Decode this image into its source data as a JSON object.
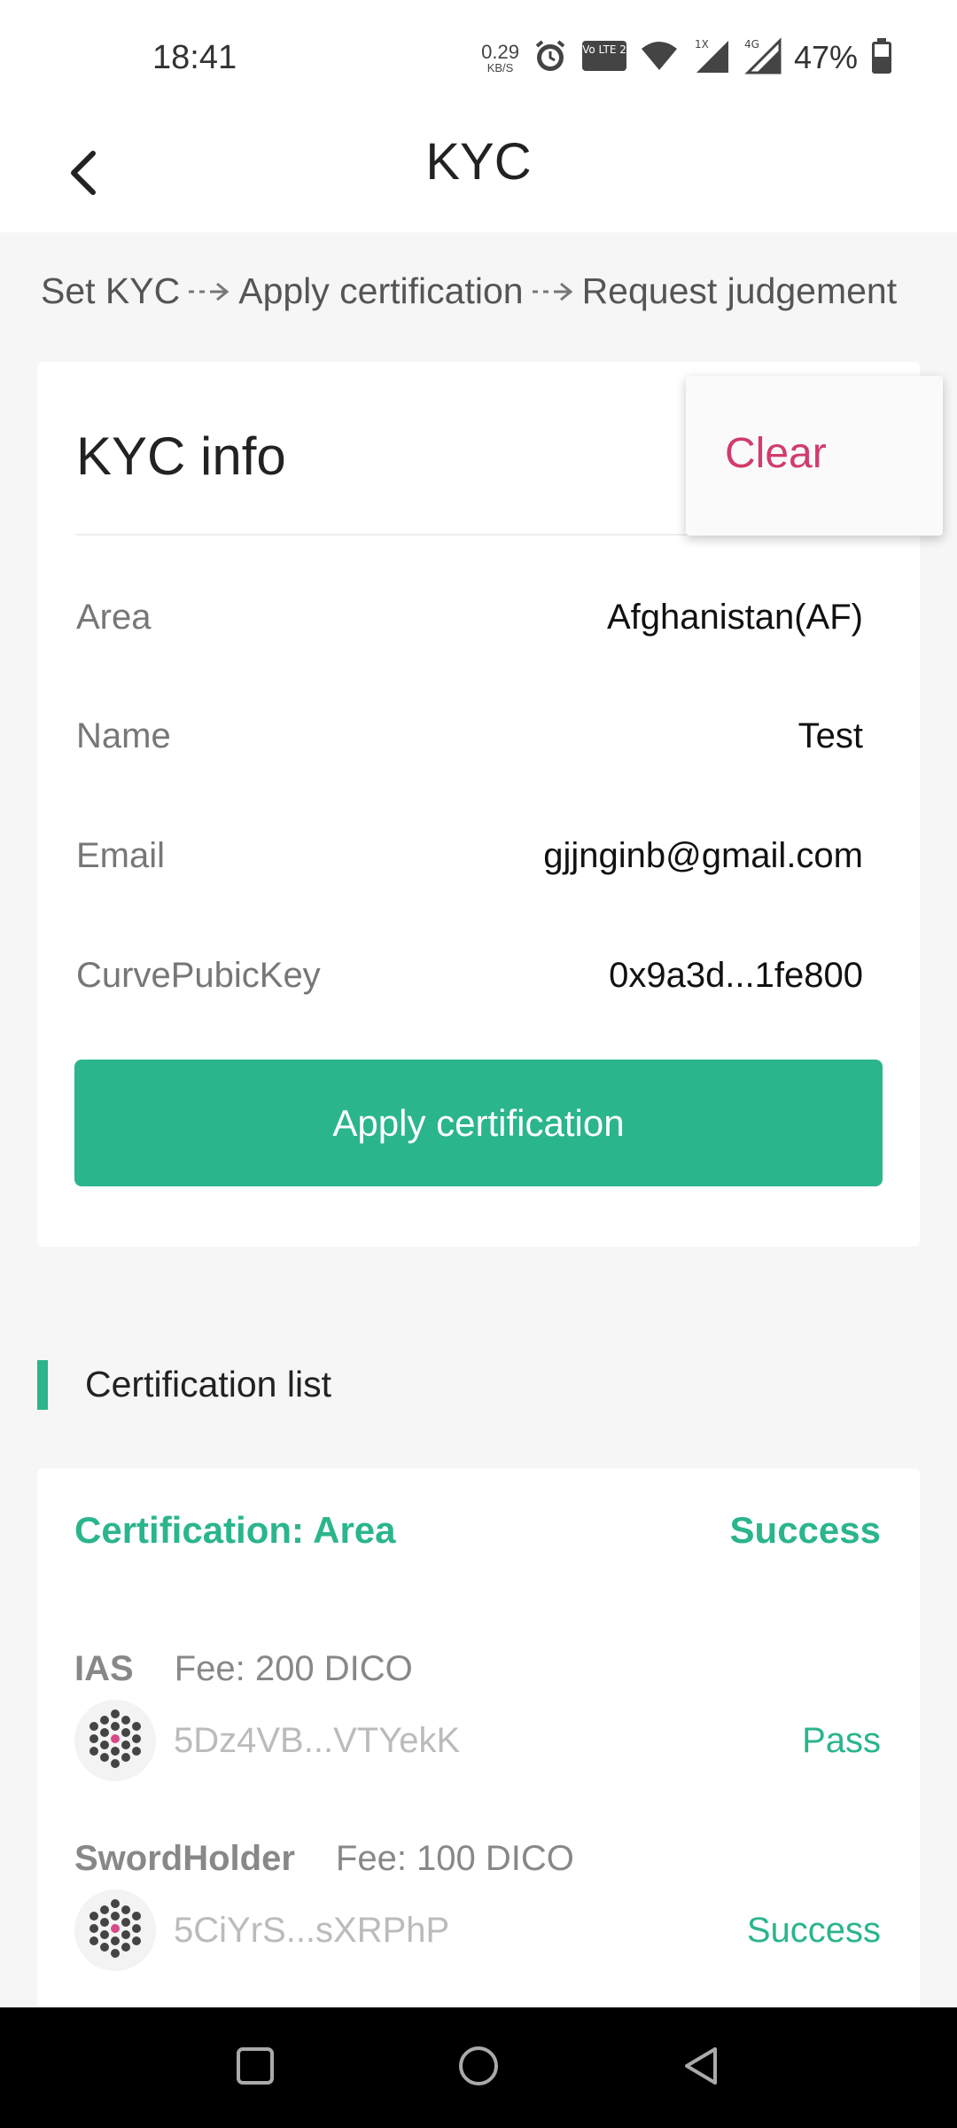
{
  "status_bar": {
    "time": "18:41",
    "net_speed_value": "0.29",
    "net_speed_unit": "KB/S",
    "volte_label": "Vo LTE 2",
    "sig1_label": "1X",
    "sig2_label": "4G",
    "battery": "47%",
    "icons": [
      "alarm-icon",
      "volte-icon",
      "wifi-icon",
      "signal-icon",
      "signal-4g-icon",
      "battery-icon"
    ]
  },
  "header": {
    "title": "KYC",
    "back_icon": "back-arrow-icon"
  },
  "steps": [
    "Set KYC",
    "Apply certification",
    "Request judgement"
  ],
  "kyc": {
    "title": "KYC info",
    "fields": [
      {
        "label": "Area",
        "value": "Afghanistan(AF)"
      },
      {
        "label": "Name",
        "value": "Test"
      },
      {
        "label": "Email",
        "value": "gjjnginb@gmail.com"
      },
      {
        "label": "CurvePubicKey",
        "value": "0x9a3d...1fe800"
      }
    ],
    "apply_label": "Apply certification"
  },
  "popup_menu": {
    "items": [
      "Clear"
    ]
  },
  "cert_section": {
    "title": "Certification list",
    "card": {
      "title": "Certification: Area",
      "status": "Success",
      "registrars": [
        {
          "name": "IAS",
          "fee": "Fee: 200 DICO",
          "address": "5Dz4VB...VTYekK",
          "status": "Pass"
        },
        {
          "name": "SwordHolder",
          "fee": "Fee: 100 DICO",
          "address": "5CiYrS...sXRPhP",
          "status": "Success"
        }
      ]
    }
  },
  "colors": {
    "accent": "#2bb58c",
    "danger": "#d23c6a",
    "background": "#f6f6f6"
  }
}
